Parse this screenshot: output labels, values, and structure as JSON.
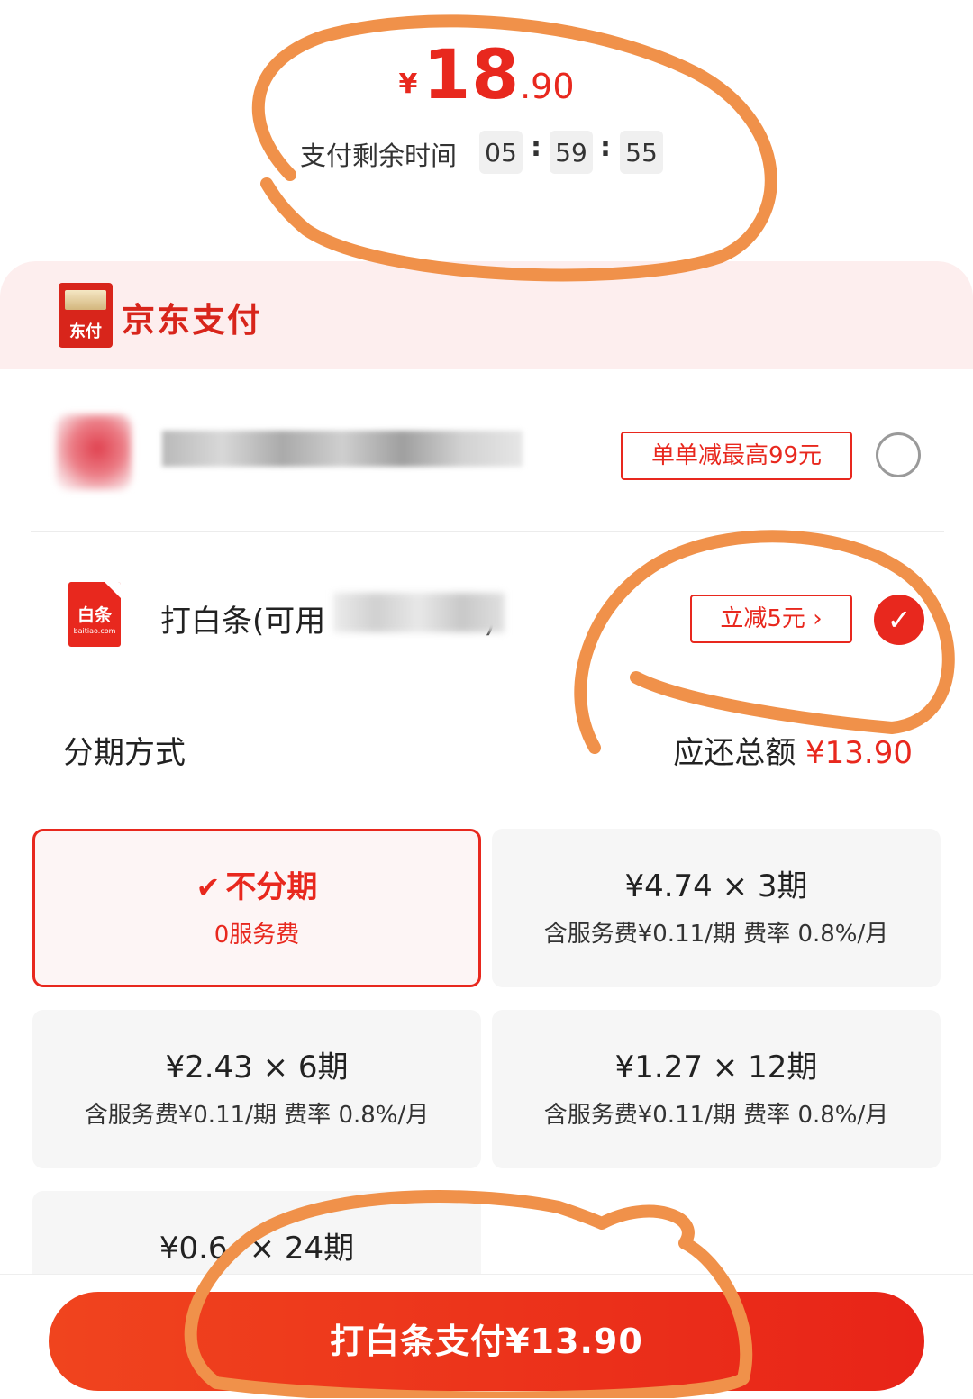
{
  "price": {
    "currency": "¥",
    "integer": "18",
    "decimal": ".90"
  },
  "timer": {
    "label": "支付剩余时间",
    "hours": "05",
    "minutes": "59",
    "seconds": "55",
    "separator": ":"
  },
  "header": {
    "logo_text": "东付",
    "title": "京东支付"
  },
  "methods": [
    {
      "tag": "单单减最高99元",
      "selected": false
    },
    {
      "label": "打白条(可用",
      "label_tail": ")",
      "tag": "立减5元 ›",
      "selected": true,
      "icon_text": "白条",
      "icon_sub": "baitiao.com"
    }
  ],
  "installment": {
    "label": "分期方式",
    "total_label": "应还总额",
    "total_value": "¥13.90",
    "options": [
      {
        "main": "不分期",
        "sub": "0服务费",
        "selected": true
      },
      {
        "main": "¥4.74 × 3期",
        "sub": "含服务费¥0.11/期 费率 0.8%/月"
      },
      {
        "main": "¥2.43 × 6期",
        "sub": "含服务费¥0.11/期 费率 0.8%/月"
      },
      {
        "main": "¥1.27 × 12期",
        "sub": "含服务费¥0.11/期 费率 0.8%/月"
      },
      {
        "main": "¥0.6",
        "main_tail": "× 24期"
      }
    ]
  },
  "pay_button": "打白条支付¥13.90",
  "colors": {
    "accent": "#e8281e",
    "annotation": "#f0914a",
    "header_bg": "#fdeeee"
  },
  "icons": {
    "unchecked": "radio-empty-icon",
    "checked": "checkmark-icon",
    "check_small": "check-icon"
  }
}
